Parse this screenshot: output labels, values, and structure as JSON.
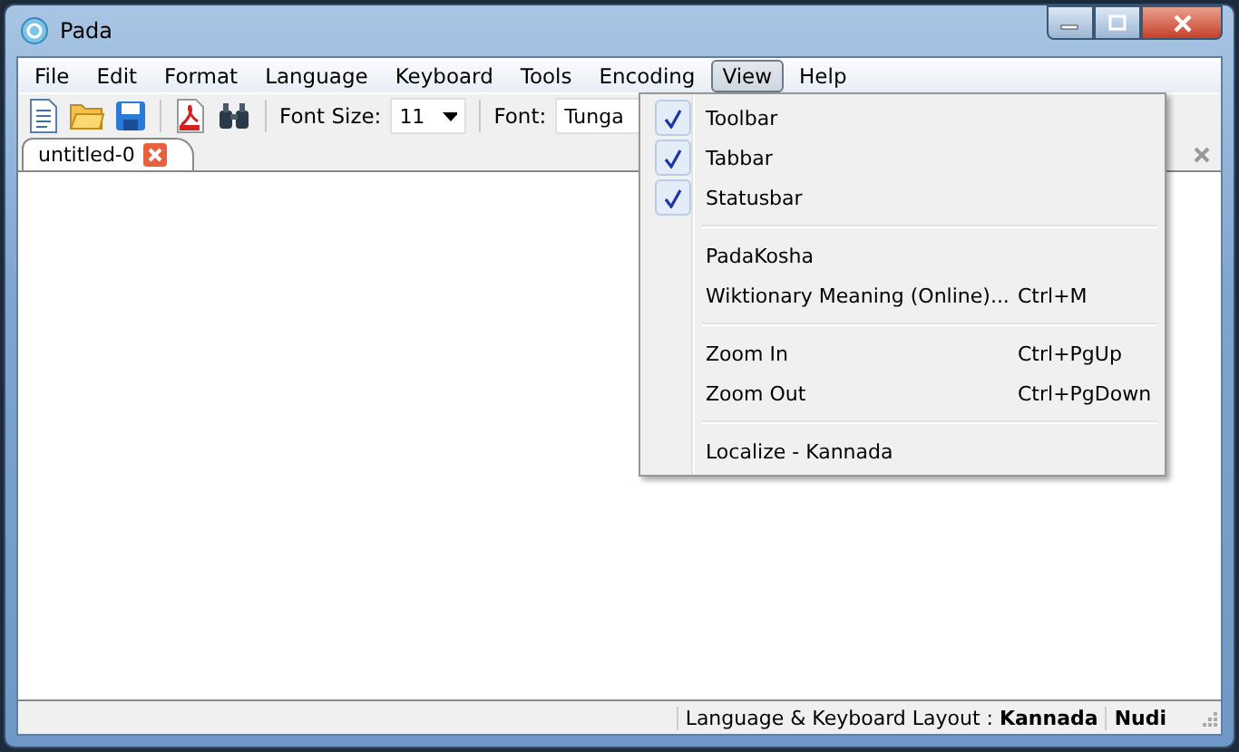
{
  "window": {
    "title": "Pada"
  },
  "menubar": [
    {
      "label": "File",
      "selected": false
    },
    {
      "label": "Edit",
      "selected": false
    },
    {
      "label": "Format",
      "selected": false
    },
    {
      "label": "Language",
      "selected": false
    },
    {
      "label": "Keyboard",
      "selected": false
    },
    {
      "label": "Tools",
      "selected": false
    },
    {
      "label": "Encoding",
      "selected": false
    },
    {
      "label": "View",
      "selected": true
    },
    {
      "label": "Help",
      "selected": false
    }
  ],
  "toolbar": {
    "font_size_label": "Font Size:",
    "font_size": "11",
    "font_label": "Font:",
    "font": "Tunga"
  },
  "tabs": [
    {
      "label": "untitled-0",
      "selected": true
    }
  ],
  "view_menu": [
    {
      "kind": "check",
      "label": "Toolbar",
      "checked": true
    },
    {
      "kind": "check",
      "label": "Tabbar",
      "checked": true
    },
    {
      "kind": "check",
      "label": "Statusbar",
      "checked": true
    },
    {
      "kind": "separator"
    },
    {
      "kind": "item",
      "label": "PadaKosha"
    },
    {
      "kind": "item",
      "label": "Wiktionary Meaning (Online)...",
      "shortcut": "Ctrl+M"
    },
    {
      "kind": "separator"
    },
    {
      "kind": "item",
      "label": "Zoom In",
      "shortcut": "Ctrl+PgUp"
    },
    {
      "kind": "item",
      "label": "Zoom Out",
      "shortcut": "Ctrl+PgDown"
    },
    {
      "kind": "separator"
    },
    {
      "kind": "item",
      "label": "Localize - Kannada"
    }
  ],
  "status_bar": {
    "layout": "Language & Keyboard Layout : **Kannada**",
    "keyboard": "Nudi"
  }
}
